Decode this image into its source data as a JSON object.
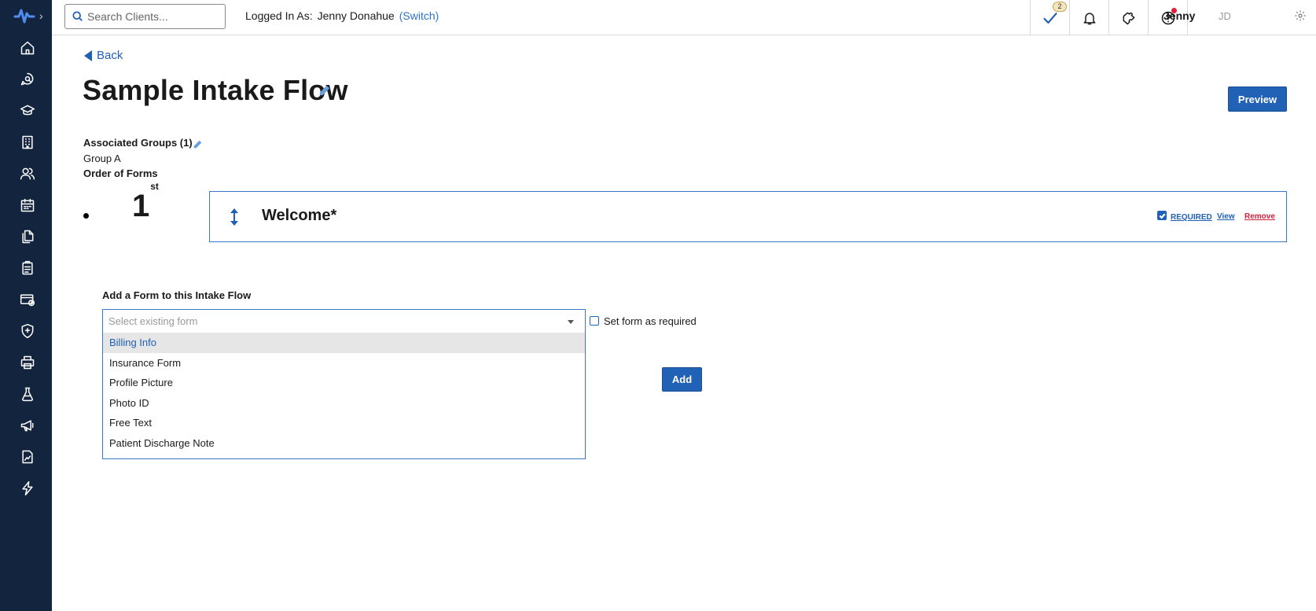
{
  "sidebar": {
    "logo_icon": "brand-wave-logo",
    "expand_icon": "chevron-right-icon",
    "items": [
      {
        "icon": "home-icon"
      },
      {
        "icon": "search-chat-icon"
      },
      {
        "icon": "graduation-cap-icon"
      },
      {
        "icon": "building-icon"
      },
      {
        "icon": "users-icon"
      },
      {
        "icon": "calendar-icon"
      },
      {
        "icon": "documents-icon"
      },
      {
        "icon": "clipboard-icon"
      },
      {
        "icon": "billing-card-icon"
      },
      {
        "icon": "shield-icon"
      },
      {
        "icon": "printer-icon"
      },
      {
        "icon": "flask-icon"
      },
      {
        "icon": "megaphone-icon"
      },
      {
        "icon": "report-icon"
      },
      {
        "icon": "lightning-icon"
      }
    ]
  },
  "topbar": {
    "search_placeholder": "Search Clients...",
    "logged_in_label": "Logged In As:",
    "logged_in_name": "Jenny Donahue",
    "switch_label": "(Switch)",
    "tasks_badge": "2",
    "user_name": "Jenny",
    "user_initials": "JD"
  },
  "page": {
    "back_label": "Back",
    "title": "Sample Intake Flow",
    "preview_label": "Preview",
    "associated_groups_label": "Associated Groups (1)",
    "group_name": "Group A",
    "order_label": "Order of Forms"
  },
  "forms": [
    {
      "ordinal_number": "1",
      "ordinal_suffix": "st",
      "name": "Welcome*",
      "required": true,
      "required_label": "REQUIRED",
      "view_label": "View",
      "remove_label": "Remove"
    }
  ],
  "add_form": {
    "label": "Add a Form to this Intake Flow",
    "select_placeholder": "Select existing form",
    "options": [
      "Billing Info",
      "Insurance Form",
      "Profile Picture",
      "Photo ID",
      "Free Text",
      "Patient Discharge Note"
    ],
    "highlighted_option": "Billing Info",
    "set_required_label": "Set form as required",
    "set_required_checked": false,
    "add_label": "Add"
  },
  "colors": {
    "sidebar_bg": "#13243f",
    "primary": "#2162b6",
    "link": "#1f5fb5",
    "danger": "#d0203a"
  }
}
